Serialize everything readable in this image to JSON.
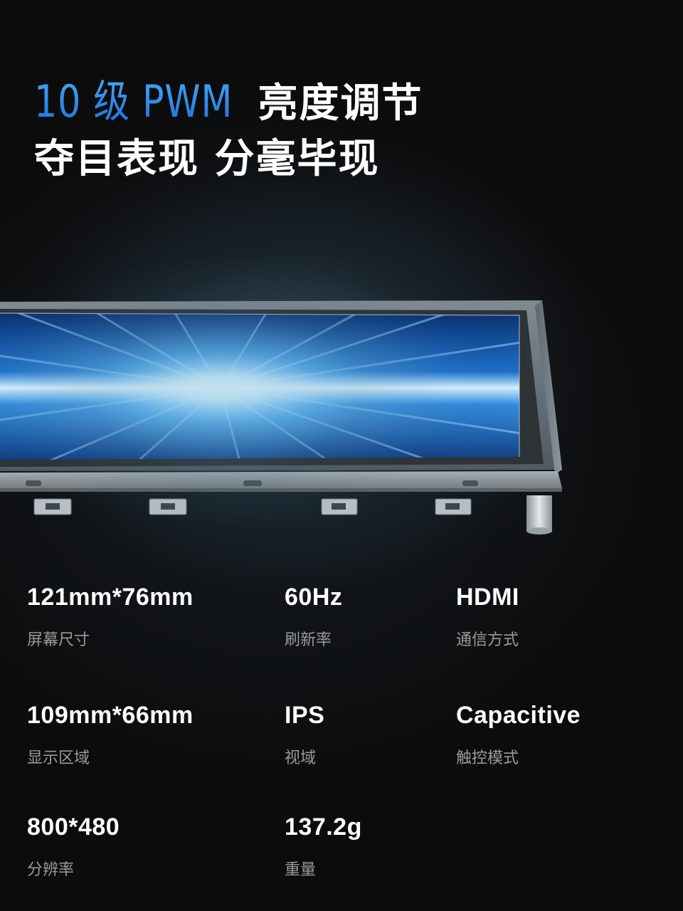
{
  "headline": {
    "accent": "10 级 PWM",
    "line1_rest": "亮度调节",
    "line2": "夺目表现  分毫毕现"
  },
  "colors": {
    "accent": "#2a8de8",
    "background": "#0c0c0d",
    "label": "#9a9a9a"
  },
  "specs": [
    {
      "value": "121mm*76mm",
      "label": "屏幕尺寸"
    },
    {
      "value": "60Hz",
      "label": "刷新率"
    },
    {
      "value": "HDMI",
      "label": "通信方式"
    },
    {
      "value": "109mm*66mm",
      "label": "显示区域"
    },
    {
      "value": "IPS",
      "label": "视域"
    },
    {
      "value": "Capacitive",
      "label": "触控模式"
    },
    {
      "value": "800*480",
      "label": "分辨率"
    },
    {
      "value": "137.2g",
      "label": "重量"
    }
  ]
}
